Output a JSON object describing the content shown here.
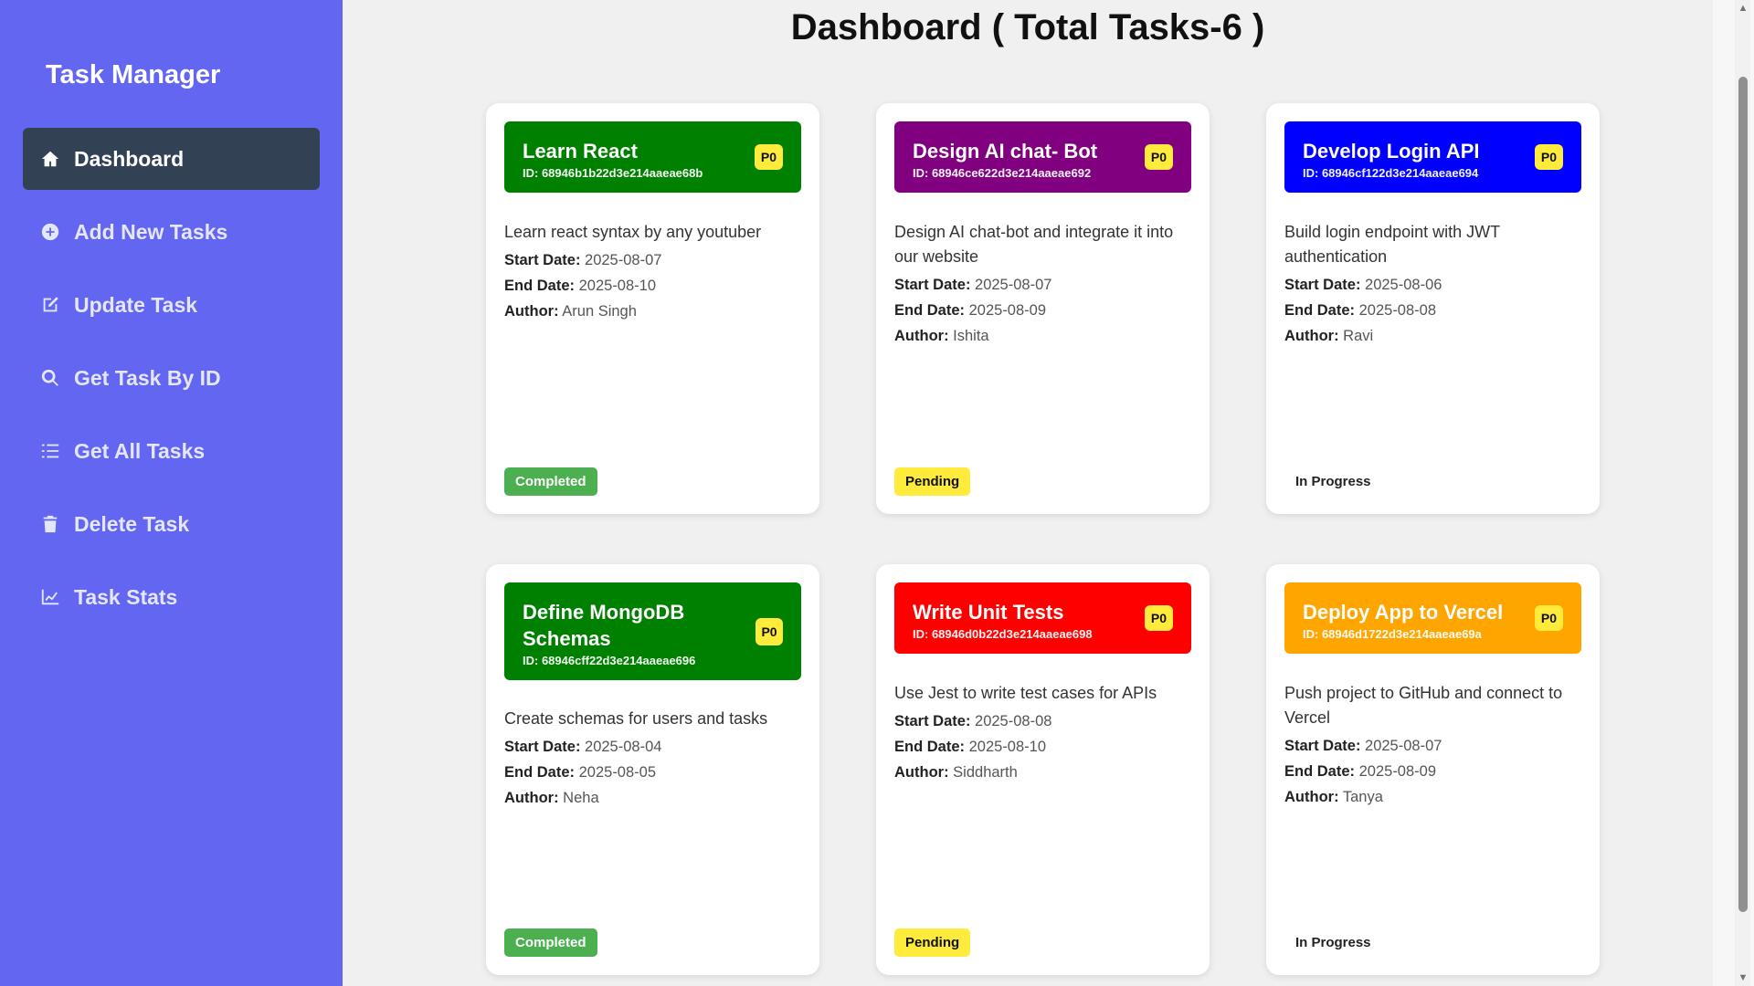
{
  "app": {
    "title": "Task Manager"
  },
  "sidebar": {
    "items": [
      {
        "label": "Dashboard",
        "icon": "home-icon",
        "active": true
      },
      {
        "label": "Add New Tasks",
        "icon": "plus-circle-icon",
        "active": false
      },
      {
        "label": "Update Task",
        "icon": "edit-icon",
        "active": false
      },
      {
        "label": "Get Task By ID",
        "icon": "search-icon",
        "active": false
      },
      {
        "label": "Get All Tasks",
        "icon": "list-icon",
        "active": false
      },
      {
        "label": "Delete Task",
        "icon": "trash-icon",
        "active": false
      },
      {
        "label": "Task Stats",
        "icon": "chart-line-icon",
        "active": false
      }
    ]
  },
  "main": {
    "title": "Dashboard ( Total Tasks-6 )",
    "tasks": [
      {
        "title": "Learn React",
        "id": "ID: 68946b1b22d3e214aaeae68b",
        "priority": "P0",
        "header_color": "#008000",
        "description": "Learn react syntax by any youtuber",
        "start_label": "Start Date:",
        "start": "2025-08-07",
        "end_label": "End Date:",
        "end": "2025-08-10",
        "author_label": "Author:",
        "author": "Arun Singh",
        "status": "Completed",
        "status_bg": "#4caf50",
        "status_fg": "#ffffff"
      },
      {
        "title": "Design AI chat- Bot",
        "id": "ID: 68946ce622d3e214aaeae692",
        "priority": "P0",
        "header_color": "#800080",
        "description": "Design AI chat-bot and integrate it into our website",
        "start_label": "Start Date:",
        "start": "2025-08-07",
        "end_label": "End Date:",
        "end": "2025-08-09",
        "author_label": "Author:",
        "author": "Ishita",
        "status": "Pending",
        "status_bg": "#ffeb3b",
        "status_fg": "#111111"
      },
      {
        "title": "Develop Login API",
        "id": "ID: 68946cf122d3e214aaeae694",
        "priority": "P0",
        "header_color": "#0000ff",
        "description": "Build login endpoint with JWT authentication",
        "start_label": "Start Date:",
        "start": "2025-08-06",
        "end_label": "End Date:",
        "end": "2025-08-08",
        "author_label": "Author:",
        "author": "Ravi",
        "status": "In Progress",
        "status_bg": "#ffffff",
        "status_fg": "#222222"
      },
      {
        "title": "Define MongoDB Schemas",
        "id": "ID: 68946cff22d3e214aaeae696",
        "priority": "P0",
        "header_color": "#008000",
        "description": "Create schemas for users and tasks",
        "start_label": "Start Date:",
        "start": "2025-08-04",
        "end_label": "End Date:",
        "end": "2025-08-05",
        "author_label": "Author:",
        "author": "Neha",
        "status": "Completed",
        "status_bg": "#4caf50",
        "status_fg": "#ffffff"
      },
      {
        "title": "Write Unit Tests",
        "id": "ID: 68946d0b22d3e214aaeae698",
        "priority": "P0",
        "header_color": "#ff0000",
        "description": "Use Jest to write test cases for APIs",
        "start_label": "Start Date:",
        "start": "2025-08-08",
        "end_label": "End Date:",
        "end": "2025-08-10",
        "author_label": "Author:",
        "author": "Siddharth",
        "status": "Pending",
        "status_bg": "#ffeb3b",
        "status_fg": "#111111"
      },
      {
        "title": "Deploy App to Vercel",
        "id": "ID: 68946d1722d3e214aaeae69a",
        "priority": "P0",
        "header_color": "#ffa500",
        "description": "Push project to GitHub and connect to Vercel",
        "start_label": "Start Date:",
        "start": "2025-08-07",
        "end_label": "End Date:",
        "end": "2025-08-09",
        "author_label": "Author:",
        "author": "Tanya",
        "status": "In Progress",
        "status_bg": "#ffffff",
        "status_fg": "#222222"
      }
    ]
  },
  "colors": {
    "sidebar_bg": "#6366f1",
    "active_item_bg": "#334155",
    "page_bg": "#f0f0f0"
  }
}
